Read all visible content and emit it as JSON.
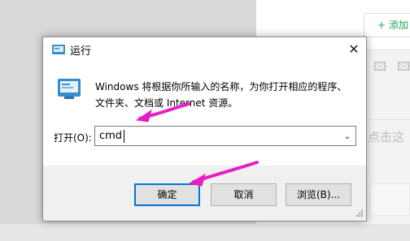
{
  "background": {
    "add_button": "+ 添加",
    "image_placeholder_1": "🖾",
    "image_placeholder_2": "🖾",
    "hint_text": "点击这"
  },
  "dialog": {
    "title": "运行",
    "close_symbol": "✕",
    "description_line1": "Windows 将根据你所输入的名称，为你打开相应的程序、",
    "description_line2": "文件夹、文档或 Internet 资源。",
    "open_label": "打开(O):",
    "open_value": "cmd",
    "dropdown_symbol": "⌄",
    "ok_label": "确定",
    "cancel_label": "取消",
    "browse_label": "浏览(B)..."
  },
  "annotation_color": "#e61ec4",
  "icons": [
    "run-title-icon",
    "run-program-icon",
    "close-icon",
    "chevron-down-icon",
    "resize-grip-icon"
  ]
}
